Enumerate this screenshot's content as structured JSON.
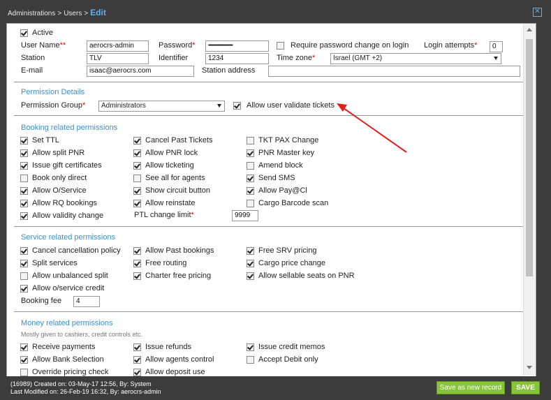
{
  "header": {
    "breadcrumb_1": "Administrations",
    "breadcrumb_2": "Users",
    "separator": ">",
    "current": "Edit",
    "close": "✕"
  },
  "user": {
    "active_label": "Active",
    "username_label": "User Name",
    "username_req": "**",
    "username": "aerocrs-admin",
    "password_label": "Password",
    "password_value": "••••••••••••••••••••••••",
    "require_pw_change_label": "Require password change on login",
    "login_attempts_label": "Login attempts",
    "login_attempts": "0",
    "station_label": "Station",
    "station": "TLV",
    "identifier_label": "Identifier",
    "identifier": "1234",
    "timezone_label": "Time zone",
    "timezone": "Israel (GMT +2)",
    "email_label": "E-mail",
    "email": "isaac@aerocrs.com",
    "station_address_label": "Station address",
    "station_address": "",
    "req": "*"
  },
  "permission_details": {
    "title": "Permission Details",
    "group_label": "Permission Group",
    "group": "Administrators",
    "allow_validate_label": "Allow user validate tickets"
  },
  "booking": {
    "title": "Booking related permissions",
    "items": [
      {
        "label": "Set TTL",
        "checked": true
      },
      {
        "label": "Cancel Past Tickets",
        "checked": true
      },
      {
        "label": "TKT PAX Change",
        "checked": false
      },
      {
        "label": "Allow split PNR",
        "checked": true
      },
      {
        "label": "Allow PNR lock",
        "checked": true
      },
      {
        "label": "PNR Master key",
        "checked": true
      },
      {
        "label": "Issue gift certificates",
        "checked": true
      },
      {
        "label": "Allow ticketing",
        "checked": true
      },
      {
        "label": "Amend block",
        "checked": false
      },
      {
        "label": "Book only direct",
        "checked": false
      },
      {
        "label": "See all for agents",
        "checked": false
      },
      {
        "label": "Send SMS",
        "checked": true
      },
      {
        "label": "Allow O/Service",
        "checked": true
      },
      {
        "label": "Show circuit button",
        "checked": true
      },
      {
        "label": "Allow Pay@Cl",
        "checked": true
      },
      {
        "label": "Allow RQ bookings",
        "checked": true
      },
      {
        "label": "Allow reinstate",
        "checked": true
      },
      {
        "label": "Cargo Barcode scan",
        "checked": false
      },
      {
        "label": "Allow validity change",
        "checked": true
      }
    ],
    "ptl_label": "PTL change limit",
    "ptl_value": "9999"
  },
  "service": {
    "title": "Service related permissions",
    "items": [
      {
        "label": "Cancel cancellation policy",
        "checked": true
      },
      {
        "label": "Allow Past bookings",
        "checked": true
      },
      {
        "label": "Free SRV pricing",
        "checked": true
      },
      {
        "label": "Split services",
        "checked": true
      },
      {
        "label": "Free routing",
        "checked": true
      },
      {
        "label": "Cargo price change",
        "checked": true
      },
      {
        "label": "Allow unbalanced split",
        "checked": false
      },
      {
        "label": "Charter free pricing",
        "checked": true
      },
      {
        "label": "Allow sellable seats on PNR",
        "checked": true
      },
      {
        "label": "Allow o/service credit",
        "checked": true
      }
    ],
    "booking_fee_label": "Booking fee",
    "booking_fee": "4"
  },
  "money": {
    "title": "Money related permissions",
    "subtitle": "Mostly given to cashiers, credit controls etc.",
    "items": [
      {
        "label": "Receive payments",
        "checked": true
      },
      {
        "label": "Issue refunds",
        "checked": true
      },
      {
        "label": "Issue credit memos",
        "checked": true
      },
      {
        "label": "Allow Bank Selection",
        "checked": true
      },
      {
        "label": "Allow agents control",
        "checked": true
      },
      {
        "label": "Accept Debit only",
        "checked": false
      },
      {
        "label": "Override pricing check",
        "checked": false
      },
      {
        "label": "Allow deposit use",
        "checked": true
      }
    ]
  },
  "footer": {
    "created": "(16989) Created on: 03-May-17 12:56, By: System",
    "modified": "Last Modified on: 26-Feb-19 16:32, By: aerocrs-admin",
    "save_new_label": "Save as new record",
    "save_label": "SAVE"
  },
  "colors": {
    "accent": "#3a8fd0",
    "button": "#88c33b",
    "annotation_arrow": "#e02020"
  }
}
